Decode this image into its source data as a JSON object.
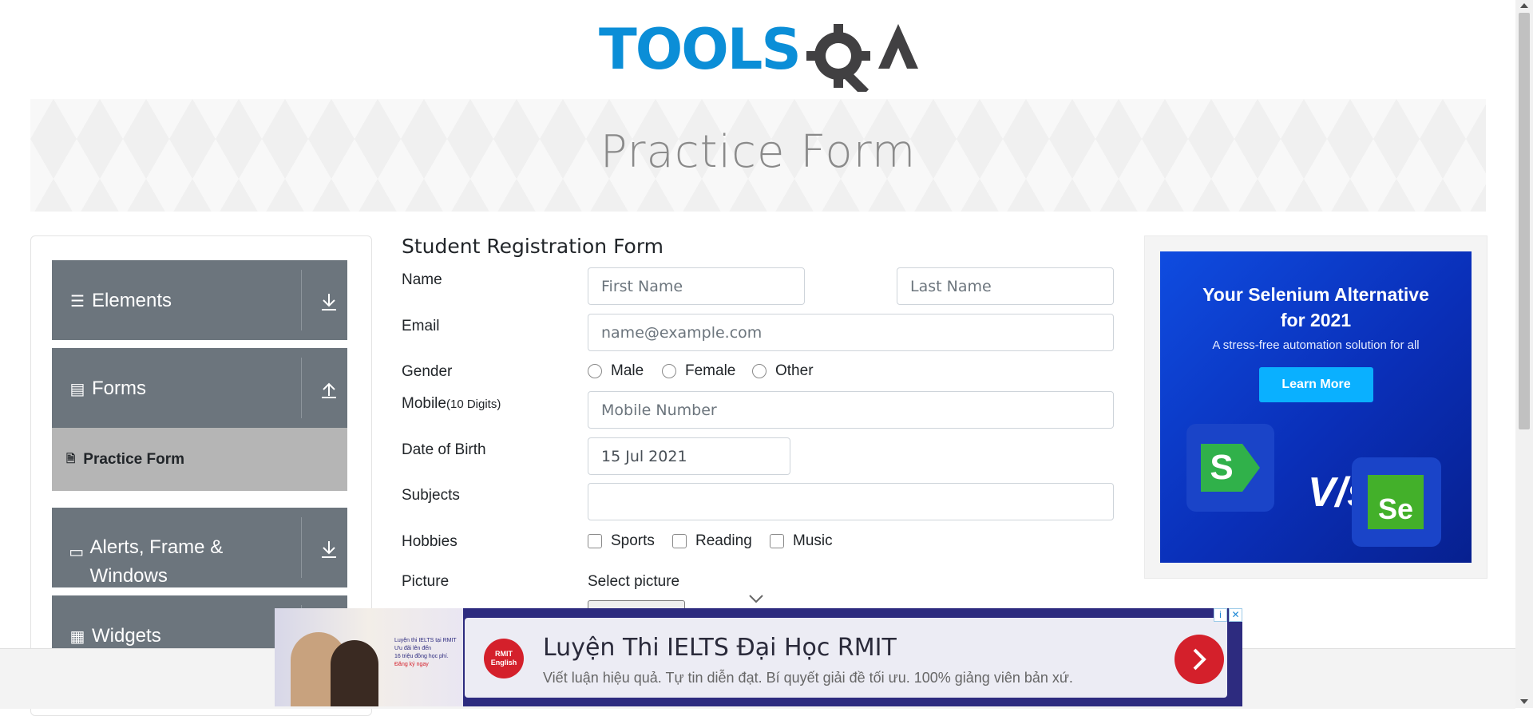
{
  "brand": {
    "logo_text": "TOOLSQA"
  },
  "banner": {
    "title": "Practice Form"
  },
  "sidebar": {
    "groups": [
      {
        "label": "Elements",
        "icon": "menu-icon",
        "state": "collapsed"
      },
      {
        "label": "Forms",
        "icon": "form-icon",
        "state": "expanded"
      },
      {
        "label": "Alerts, Frame & Windows",
        "icon": "window-icon",
        "state": "collapsed"
      },
      {
        "label": "Widgets",
        "icon": "widgets-icon",
        "state": "collapsed"
      }
    ],
    "active_item": {
      "label": "Practice Form",
      "icon": "doc-icon"
    }
  },
  "form": {
    "title": "Student Registration Form",
    "name_label": "Name",
    "first_name_placeholder": "First Name",
    "last_name_placeholder": "Last Name",
    "email_label": "Email",
    "email_placeholder": "name@example.com",
    "gender_label": "Gender",
    "genders": [
      "Male",
      "Female",
      "Other"
    ],
    "mobile_label": "Mobile",
    "mobile_hint": "(10 Digits)",
    "mobile_placeholder": "Mobile Number",
    "dob_label": "Date of Birth",
    "dob_value": "15 Jul 2021",
    "subjects_label": "Subjects",
    "hobbies_label": "Hobbies",
    "hobbies": [
      "Sports",
      "Reading",
      "Music"
    ],
    "picture_label": "Picture",
    "picture_button": "Select picture"
  },
  "side_ad": {
    "headline_line1": "Your Selenium Alternative",
    "headline_line2": "for 2021",
    "subline": "A stress-free automation solution for all",
    "cta": "Learn More",
    "vs": "V/s",
    "left_logo": "S",
    "right_logo": "Se"
  },
  "bottom_ad": {
    "title": "Luyện Thi IELTS Đại Học RMIT",
    "description": "Viết luận hiệu quả. Tự tin diễn đạt. Bí quyết giải đề tối ưu. 100% giảng viên bản xứ.",
    "badge_line1": "RMIT",
    "badge_line2": "English",
    "photo_text_1": "Luyện thi IELTS tại RMIT",
    "photo_text_2": "Ưu đãi lên đến",
    "photo_text_3": "16 triệu đồng học phí.",
    "photo_cta": "Đăng ký ngay",
    "info_glyph": "i",
    "close_glyph": "✕"
  },
  "colors": {
    "sidebar_bg": "#6c757d",
    "sidebar_active": "#b5b5b5",
    "logo_blue": "#0b8ed7",
    "logo_dark": "#414042",
    "ad_blue": "#0f4ce0",
    "ad_button": "#0ab0ff"
  }
}
